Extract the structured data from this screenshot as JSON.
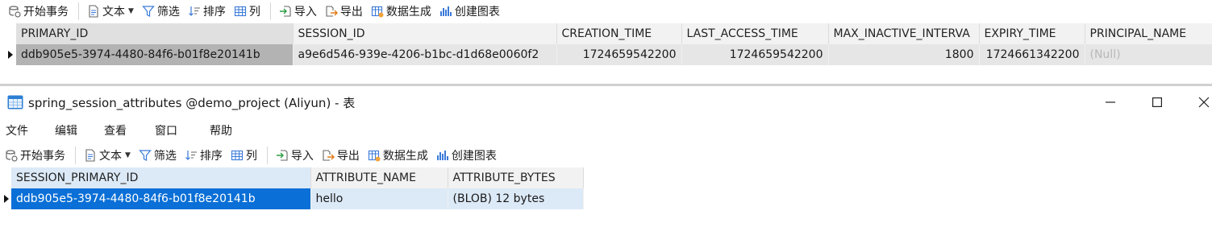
{
  "toolbar": {
    "begin_transaction": "开始事务",
    "text": "文本",
    "filter": "筛选",
    "sort": "排序",
    "columns": "列",
    "import": "导入",
    "export": "导出",
    "data_generation": "数据生成",
    "create_chart": "创建图表"
  },
  "sessions_table": {
    "columns": [
      "PRIMARY_ID",
      "SESSION_ID",
      "CREATION_TIME",
      "LAST_ACCESS_TIME",
      "MAX_INACTIVE_INTERVA",
      "EXPIRY_TIME",
      "PRINCIPAL_NAME"
    ],
    "row": {
      "primary_id": "ddb905e5-3974-4480-84f6-b01f8e20141b",
      "session_id": "a9e6d546-939e-4206-b1bc-d1d68e0060f2",
      "creation_time": "1724659542200",
      "last_access_time": "1724659542200",
      "max_inactive_interval": "1800",
      "expiry_time": "1724661342200",
      "principal_name": "(Null)"
    }
  },
  "window": {
    "title": "spring_session_attributes @demo_project (Aliyun) - 表"
  },
  "menu": {
    "file": "文件",
    "edit": "编辑",
    "view": "查看",
    "window": "窗口",
    "help": "帮助"
  },
  "attributes_table": {
    "columns": [
      "SESSION_PRIMARY_ID",
      "ATTRIBUTE_NAME",
      "ATTRIBUTE_BYTES"
    ],
    "row": {
      "session_primary_id": "ddb905e5-3974-4480-84f6-b01f8e20141b",
      "attribute_name": "hello",
      "attribute_bytes": "(BLOB) 12 bytes"
    }
  },
  "colors": {
    "selected_cell": "#0a6fd6",
    "row_highlight": "#dce9f7",
    "sessions_row": "#e6e6e6",
    "sessions_row_selected": "#b3b3b3"
  },
  "icons": [
    "transaction-icon",
    "text-icon",
    "filter-icon",
    "sort-icon",
    "columns-icon",
    "import-icon",
    "export-icon",
    "data-generation-icon",
    "create-chart-icon",
    "table-app-icon",
    "minimize-icon",
    "maximize-icon",
    "close-icon",
    "row-pointer-icon"
  ]
}
